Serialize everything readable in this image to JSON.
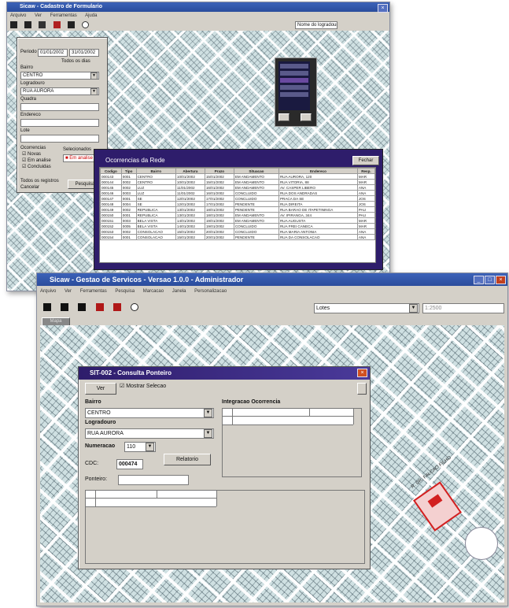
{
  "top": {
    "title": "Sicaw - Cadastro de Formulario",
    "menu": [
      "Arquivo",
      "Ver",
      "Ferramentas",
      "Ajuda"
    ],
    "search_value": "Nome do logradouro",
    "filter_panel": {
      "period_label": "Periodo",
      "period_from": "01/01/2002",
      "period_to": "31/01/2002",
      "all_days_label": "Todos os dias",
      "field1_label": "Bairro",
      "field1_value": "CENTRO",
      "field2_label": "Logradouro",
      "field2_value": "RUA AURORA",
      "field3_label": "Quadra",
      "field4_label": "Endereco",
      "field5_label": "Lote",
      "checks_label": "Ocorrencias",
      "checks": [
        "Novas",
        "Em analise",
        "Concluidas"
      ],
      "selection_label": "Selecionados",
      "all_records_label": "Todos os registros",
      "cancel_label": "Cancelar",
      "search_button": "Pesquisar"
    },
    "records_panel": {
      "title": "Ocorrencias da Rede",
      "close_button": "Fechar",
      "columns": [
        "Codigo",
        "Tipo",
        "Bairro",
        "Abertura",
        "Prazo",
        "Situacao",
        "Endereco",
        "Resp."
      ],
      "rows": [
        [
          "000143",
          "0001",
          "CENTRO",
          "10/01/2002",
          "15/01/2002",
          "EM ANDAMENTO",
          "RUA AURORA, 120",
          "MAR"
        ],
        [
          "000144",
          "0002",
          "CENTRO",
          "10/01/2002",
          "15/01/2002",
          "EM ANDAMENTO",
          "RUA VITORIA, 88",
          "MAR"
        ],
        [
          "000145",
          "0002",
          "LUZ",
          "11/01/2002",
          "16/01/2002",
          "EM ANDAMENTO",
          "AV. CASPER LIBERO",
          "ANA"
        ],
        [
          "000146",
          "0003",
          "LUZ",
          "11/01/2002",
          "16/01/2002",
          "CONCLUIDO",
          "RUA DOS ANDRADAS",
          "ANA"
        ],
        [
          "000147",
          "0001",
          "SE",
          "12/01/2002",
          "17/01/2002",
          "CONCLUIDO",
          "PRACA DA SE",
          "JOS"
        ],
        [
          "000148",
          "0004",
          "SE",
          "12/01/2002",
          "17/01/2002",
          "PENDENTE",
          "RUA DIREITA",
          "JOS"
        ],
        [
          "000149",
          "0002",
          "REPUBLICA",
          "13/01/2002",
          "18/01/2002",
          "PENDENTE",
          "RUA BARAO DE ITAPETININGA",
          "PAU"
        ],
        [
          "000150",
          "0001",
          "REPUBLICA",
          "13/01/2002",
          "18/01/2002",
          "EM ANDAMENTO",
          "AV. IPIRANGA, 344",
          "PAU"
        ],
        [
          "000151",
          "0003",
          "BELA VISTA",
          "14/01/2002",
          "19/01/2002",
          "EM ANDAMENTO",
          "RUA AUGUSTA",
          "MAR"
        ],
        [
          "000152",
          "0005",
          "BELA VISTA",
          "14/01/2002",
          "19/01/2002",
          "CONCLUIDO",
          "RUA FREI CANECA",
          "MAR"
        ],
        [
          "000153",
          "0002",
          "CONSOLACAO",
          "15/01/2002",
          "20/01/2002",
          "CONCLUIDO",
          "RUA MARIA ANTONIA",
          "ANA"
        ],
        [
          "000154",
          "0001",
          "CONSOLACAO",
          "15/01/2002",
          "20/01/2002",
          "PENDENTE",
          "RUA DA CONSOLACAO",
          "ANA"
        ]
      ]
    }
  },
  "bottom": {
    "title": "Sicaw - Gestao de Servicos - Versao 1.0.0 - Administrador",
    "menu": [
      "Arquivo",
      "Ver",
      "Ferramentas",
      "Pesquisa",
      "Marcacao",
      "Janela",
      "Personalizacao"
    ],
    "combo_value": "Lotes",
    "combo_right": "1:2500",
    "tab_label": "Mapa",
    "dialog": {
      "title": "SIT-002 - Consulta Ponteiro",
      "button_ver": "Ver",
      "check_label": "Mostrar Selecao",
      "bairro_label": "Bairro",
      "bairro_value": "CENTRO",
      "logradouro_label": "Logradouro",
      "logradouro_value": "RUA AURORA",
      "numeracao_label": "Numeracao",
      "numeracao_value": "110",
      "cdc_label": "CDC:",
      "cdc_value": "000474",
      "relatorio_button": "Relatorio",
      "hidrometro_label": "Ponteiro:",
      "ocorrencias_label": "Integracao Ocorrencia"
    },
    "street_label": "R. DR. FALCAO FILHO"
  },
  "colors": {
    "title_blue": "#2a4c9c",
    "dialog_purple": "#2e1d6b",
    "highlight_red": "#d22020",
    "map_base": "#cfe0e2"
  }
}
